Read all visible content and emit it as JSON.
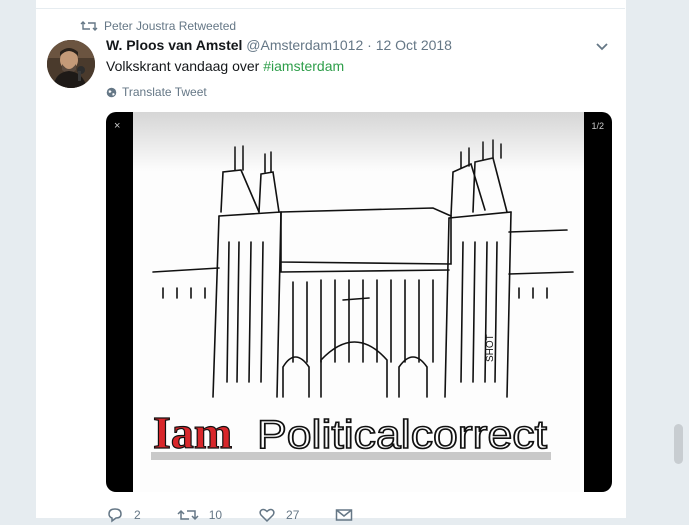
{
  "retweet_context": "Peter Joustra Retweeted",
  "tweet": {
    "fullname": "W. Ploos van Amstel",
    "username": "@Amsterdam1012",
    "separator": "·",
    "timestamp": "12 Oct 2018",
    "text_prefix": "Volkskrant vandaag over ",
    "hashtag": "#iamsterdam",
    "translate_label": "Translate Tweet"
  },
  "media": {
    "counter": "1/2",
    "close_glyph": "×",
    "cartoon_text_red": "Iam",
    "cartoon_text_outline": "Politicalcorrect",
    "cartoon_signature": "SHOT"
  },
  "actions": {
    "reply_count": "2",
    "retweet_count": "10",
    "like_count": "27"
  },
  "colors": {
    "hashtag": "#2e9e4a",
    "secondary_text": "#657786",
    "background": "#e6ecf0",
    "cartoon_red": "#d8272b"
  },
  "icons": {
    "retweet_context": "retweet-icon",
    "caret": "chevron-down-icon",
    "translate": "globe-icon",
    "reply": "reply-icon",
    "retweet": "retweet-icon",
    "like": "heart-icon",
    "dm": "envelope-icon"
  }
}
